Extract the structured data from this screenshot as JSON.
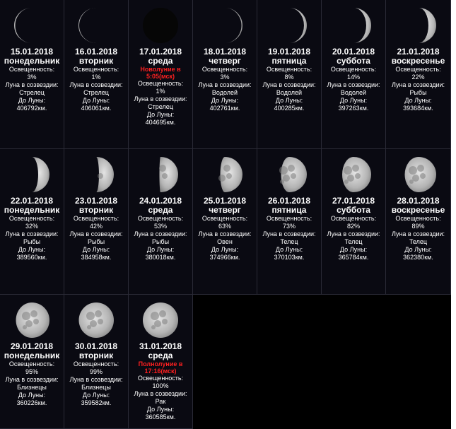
{
  "labels": {
    "illumination": "Освещенность:",
    "constellation": "Луна в созвездии:",
    "distance": "До Луны:"
  },
  "days": [
    {
      "date": "15.01.2018",
      "weekday": "понедельник",
      "illumination": "3%",
      "constellation": "Стрелец",
      "distance": "406792км.",
      "event": "",
      "phase": "waning",
      "fraction": 0.03
    },
    {
      "date": "16.01.2018",
      "weekday": "вторник",
      "illumination": "1%",
      "constellation": "Стрелец",
      "distance": "406061км.",
      "event": "",
      "phase": "waning",
      "fraction": 0.01
    },
    {
      "date": "17.01.2018",
      "weekday": "среда",
      "illumination": "1%",
      "constellation": "Стрелец",
      "distance": "404695км.",
      "event": "Новолуние в 5:05(мск)",
      "phase": "new",
      "fraction": 0.0
    },
    {
      "date": "18.01.2018",
      "weekday": "четверг",
      "illumination": "3%",
      "constellation": "Водолей",
      "distance": "402761км.",
      "event": "",
      "phase": "waxing",
      "fraction": 0.03
    },
    {
      "date": "19.01.2018",
      "weekday": "пятница",
      "illumination": "8%",
      "constellation": "Водолей",
      "distance": "400285км.",
      "event": "",
      "phase": "waxing",
      "fraction": 0.08
    },
    {
      "date": "20.01.2018",
      "weekday": "суббота",
      "illumination": "14%",
      "constellation": "Водолей",
      "distance": "397263км.",
      "event": "",
      "phase": "waxing",
      "fraction": 0.14
    },
    {
      "date": "21.01.2018",
      "weekday": "воскресенье",
      "illumination": "22%",
      "constellation": "Рыбы",
      "distance": "393684км.",
      "event": "",
      "phase": "waxing",
      "fraction": 0.22
    },
    {
      "date": "22.01.2018",
      "weekday": "понедельник",
      "illumination": "32%",
      "constellation": "Рыбы",
      "distance": "389560км.",
      "event": "",
      "phase": "waxing",
      "fraction": 0.32
    },
    {
      "date": "23.01.2018",
      "weekday": "вторник",
      "illumination": "42%",
      "constellation": "Рыбы",
      "distance": "384958км.",
      "event": "",
      "phase": "waxing",
      "fraction": 0.42
    },
    {
      "date": "24.01.2018",
      "weekday": "среда",
      "illumination": "53%",
      "constellation": "Рыбы",
      "distance": "380018км.",
      "event": "",
      "phase": "waxing",
      "fraction": 0.53
    },
    {
      "date": "25.01.2018",
      "weekday": "четверг",
      "illumination": "63%",
      "constellation": "Овен",
      "distance": "374966км.",
      "event": "",
      "phase": "waxing",
      "fraction": 0.63
    },
    {
      "date": "26.01.2018",
      "weekday": "пятница",
      "illumination": "73%",
      "constellation": "Телец",
      "distance": "370103км.",
      "event": "",
      "phase": "waxing",
      "fraction": 0.73
    },
    {
      "date": "27.01.2018",
      "weekday": "суббота",
      "illumination": "82%",
      "constellation": "Телец",
      "distance": "365784км.",
      "event": "",
      "phase": "waxing",
      "fraction": 0.82
    },
    {
      "date": "28.01.2018",
      "weekday": "воскресенье",
      "illumination": "89%",
      "constellation": "Телец",
      "distance": "362380км.",
      "event": "",
      "phase": "waxing",
      "fraction": 0.89
    },
    {
      "date": "29.01.2018",
      "weekday": "понедельник",
      "illumination": "95%",
      "constellation": "Близнецы",
      "distance": "360226км.",
      "event": "",
      "phase": "waxing",
      "fraction": 0.95
    },
    {
      "date": "30.01.2018",
      "weekday": "вторник",
      "illumination": "99%",
      "constellation": "Близнецы",
      "distance": "359582км.",
      "event": "",
      "phase": "waxing",
      "fraction": 0.99
    },
    {
      "date": "31.01.2018",
      "weekday": "среда",
      "illumination": "100%",
      "constellation": "Рак",
      "distance": "360585км.",
      "event": "Полнолуние в 17:16(мск)",
      "phase": "full",
      "fraction": 1.0
    }
  ]
}
